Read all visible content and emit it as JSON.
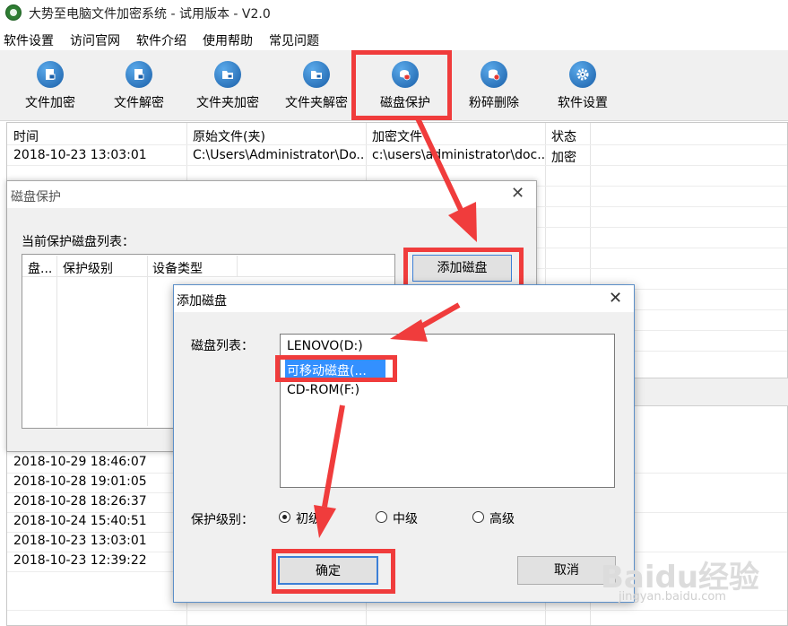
{
  "window": {
    "title": "大势至电脑文件加密系统 - 试用版本 - V2.0"
  },
  "menu": [
    "软件设置",
    "访问官网",
    "软件介绍",
    "使用帮助",
    "常见问题"
  ],
  "toolbar": [
    {
      "label": "文件加密",
      "icon": "file-lock-icon"
    },
    {
      "label": "文件解密",
      "icon": "file-unlock-icon"
    },
    {
      "label": "文件夹加密",
      "icon": "folder-lock-icon"
    },
    {
      "label": "文件夹解密",
      "icon": "folder-unlock-icon"
    },
    {
      "label": "磁盘保护",
      "icon": "disk-shield-icon"
    },
    {
      "label": "粉碎删除",
      "icon": "shred-icon"
    },
    {
      "label": "软件设置",
      "icon": "gear-icon"
    }
  ],
  "table": {
    "headers": [
      "时间",
      "原始文件(夹)",
      "加密文件",
      "状态"
    ],
    "first_row": {
      "time": "2018-10-23 13:03:01",
      "original": "C:\\Users\\Administrator\\Do...",
      "encrypted": "c:\\users\\administrator\\doc...",
      "status": "加密"
    },
    "log_times": [
      "2018-10-29 18:46:07",
      "2018-10-28 19:01:05",
      "2018-10-28 18:26:37",
      "2018-10-24 15:40:51",
      "2018-10-23 13:03:01",
      "2018-10-23 12:39:22"
    ]
  },
  "disk_protect_dialog": {
    "title": "磁盘保护",
    "list_label": "当前保护磁盘列表：",
    "columns": [
      "盘...",
      "保护级别",
      "设备类型"
    ],
    "add_button": "添加磁盘"
  },
  "add_disk_dialog": {
    "title": "添加磁盘",
    "list_label": "磁盘列表：",
    "disks": [
      "LENOVO(D:)",
      "可移动磁盘(...",
      "CD-ROM(F:)"
    ],
    "selected_index": 1,
    "level_label": "保护级别：",
    "levels": [
      "初级",
      "中级",
      "高级"
    ],
    "selected_level": 0,
    "ok_button": "确定",
    "cancel_button": "取消"
  },
  "watermark": {
    "text": "Baidu经验",
    "url": "jingyan.baidu.com"
  },
  "colors": {
    "highlight": "#f03c3c",
    "selection": "#3390ff",
    "toolbar_bg": "#f0f0f0",
    "icon_blue": "#1a5fa8"
  }
}
